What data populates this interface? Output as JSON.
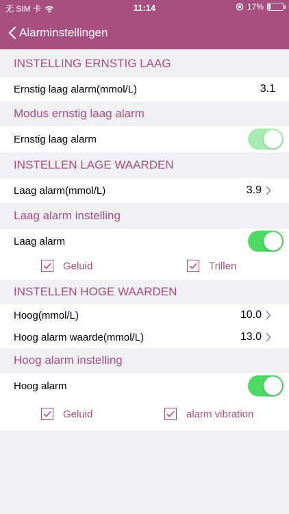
{
  "status_bar": {
    "carrier": "无 SIM 卡",
    "time": "11:14",
    "battery_pct": "17%",
    "battery_level": 0.17
  },
  "nav": {
    "title": "Alarminstellingen"
  },
  "severe_low": {
    "header": "INSTELLING ERNSTIG LAAG",
    "alarm_label": "Ernstig laag alarm(mmol/L)",
    "alarm_value": "3.1"
  },
  "severe_low_mode": {
    "header": "Modus ernstig laag alarm",
    "toggle_label": "Ernstig laag alarm",
    "toggle_on": true,
    "toggle_enabled": false
  },
  "low_values": {
    "header": "INSTELLEN LAGE WAARDEN",
    "alarm_label": "Laag alarm(mmol/L)",
    "alarm_value": "3.9"
  },
  "low_setting": {
    "header": "Laag alarm instelling",
    "toggle_label": "Laag alarm",
    "toggle_on": true,
    "sound_label": "Geluid",
    "sound_checked": true,
    "vibrate_label": "Trillen",
    "vibrate_checked": true
  },
  "high_values": {
    "header": "INSTELLEN HOGE WAARDEN",
    "high_label": "Hoog(mmol/L)",
    "high_value": "10.0",
    "high_alarm_label": "Hoog alarm waarde(mmol/L)",
    "high_alarm_value": "13.0"
  },
  "high_setting": {
    "header": "Hoog alarm instelling",
    "toggle_label": "Hoog alarm",
    "toggle_on": true,
    "sound_label": "Geluid",
    "sound_checked": true,
    "vibrate_label": "alarm vibration",
    "vibrate_checked": true
  },
  "colors": {
    "accent": "#a64f80",
    "toggle_on": "#4cd964",
    "toggle_disabled": "#a6ecb2",
    "background": "#efeff4"
  }
}
